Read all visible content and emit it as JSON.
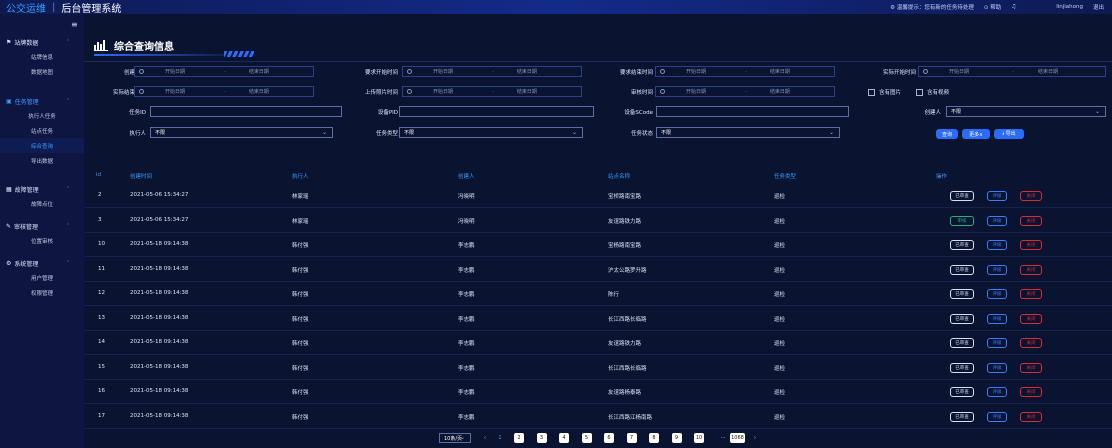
{
  "top": {
    "brand": "公交运维",
    "sep": "|",
    "system": "后台管理系统",
    "tip": "温馨提示：您有新的任务待处理",
    "help": "帮助",
    "user": "linjiahong",
    "logout": "退出"
  },
  "sidebar": {
    "groups": [
      {
        "title": "站牌数据",
        "items": [
          "站牌信息",
          "数据地图"
        ]
      },
      {
        "title": "任务管理",
        "items": [
          "执行人任务",
          "站点任务",
          "综合查询",
          "导出数据"
        ]
      },
      {
        "title": "故障管理",
        "items": [
          "故障点位"
        ]
      },
      {
        "title": "审核管理",
        "items": [
          "位置审核"
        ]
      },
      {
        "title": "系统管理",
        "items": [
          "用户管理",
          "权限管理"
        ]
      }
    ]
  },
  "page": {
    "title": "综合查询信息"
  },
  "filters": {
    "create_time": "创建时间",
    "req_start": "要求开始时间",
    "req_end": "要求结束时间",
    "act_start": "实际开始时间",
    "act_end": "实际结束时间",
    "upload_time": "上传照片时间",
    "audit_time": "审核时间",
    "start_ph": "开始日期",
    "end_ph": "结束日期",
    "dash": "-",
    "has_photo": "含有图片",
    "has_video": "含有视频",
    "task_id": "任务ID",
    "device_pid": "设备PID",
    "device_scode": "设备SCode",
    "creator": "创建人",
    "creator_val": "不限",
    "executor": "执行人",
    "executor_val": "不限",
    "task_type": "任务类型",
    "task_type_val": "不限",
    "task_status": "任务状态",
    "task_status_val": "不限",
    "query_btn": "查询",
    "more_btn": "更多∧",
    "export_btn": "⭳ 导出"
  },
  "table": {
    "headers": [
      "id",
      "创建时间",
      "执行人",
      "创建人",
      "站点名称",
      "任务类型",
      "操作"
    ],
    "rows": [
      {
        "id": "2",
        "time": "2021-05-06 15:34:27",
        "exec": "林家瑶",
        "creator": "冯晓明",
        "station": "宝桥路南宝路",
        "type": "巡检",
        "first": "已审查",
        "second": "评级",
        "third": "关闭"
      },
      {
        "id": "3",
        "time": "2021-05-06 15:34:27",
        "exec": "林家瑶",
        "creator": "冯晓明",
        "station": "友谊路铁力路",
        "type": "巡检",
        "first": "审核",
        "second": "评级",
        "third": "关闭"
      },
      {
        "id": "10",
        "time": "2021-05-18 09:14:38",
        "exec": "韩付强",
        "creator": "李志鹏",
        "station": "宝杨路南宝路",
        "type": "巡检",
        "first": "已审查",
        "second": "评级",
        "third": "关闭"
      },
      {
        "id": "11",
        "time": "2021-05-18 09:14:38",
        "exec": "韩付强",
        "creator": "李志鹏",
        "station": "沪太公路罗升路",
        "type": "巡检",
        "first": "已审查",
        "second": "评级",
        "third": "关闭"
      },
      {
        "id": "12",
        "time": "2021-05-18 09:14:38",
        "exec": "韩付强",
        "creator": "李志鹏",
        "station": "陈行",
        "type": "巡检",
        "first": "已审查",
        "second": "评级",
        "third": "关闭"
      },
      {
        "id": "13",
        "time": "2021-05-18 09:14:38",
        "exec": "韩付强",
        "creator": "李志鹏",
        "station": "长江西路长临路",
        "type": "巡检",
        "first": "已审查",
        "second": "评级",
        "third": "关闭"
      },
      {
        "id": "14",
        "time": "2021-05-18 09:14:38",
        "exec": "韩付强",
        "creator": "李志鹏",
        "station": "友谊路铁力路",
        "type": "巡检",
        "first": "已审查",
        "second": "评级",
        "third": "关闭"
      },
      {
        "id": "15",
        "time": "2021-05-18 09:14:38",
        "exec": "韩付强",
        "creator": "李志鹏",
        "station": "长江西路长临路",
        "type": "巡检",
        "first": "已审查",
        "second": "评级",
        "third": "关闭"
      },
      {
        "id": "16",
        "time": "2021-05-18 09:14:38",
        "exec": "韩付强",
        "creator": "李志鹏",
        "station": "友谊路杨泰路",
        "type": "巡检",
        "first": "已审查",
        "second": "评级",
        "third": "关闭"
      },
      {
        "id": "17",
        "time": "2021-05-18 09:14:38",
        "exec": "韩付强",
        "creator": "李志鹏",
        "station": "长江西路江杨南路",
        "type": "巡检",
        "first": "已审查",
        "second": "评级",
        "third": "关闭"
      }
    ]
  },
  "pagination": {
    "size": "10条/页",
    "prev": "‹",
    "next": "›",
    "current": "1",
    "pages": [
      "2",
      "3",
      "4",
      "5",
      "6",
      "7",
      "8",
      "9",
      "10"
    ],
    "ellipsis": "···",
    "last": "1068"
  }
}
